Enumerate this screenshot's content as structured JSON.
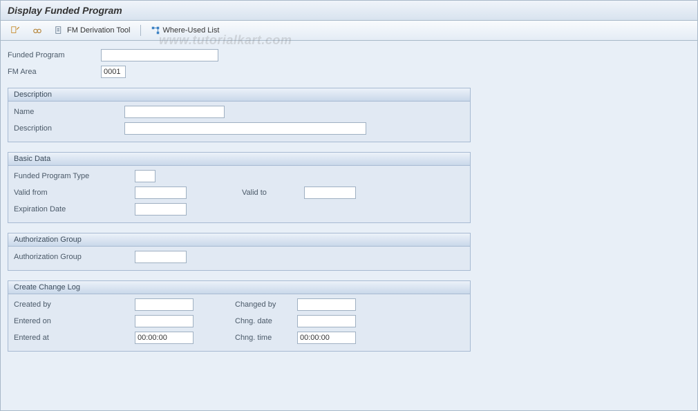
{
  "title": "Display Funded Program",
  "toolbar": {
    "fm_tool": "FM Derivation Tool",
    "where_used": "Where-Used List"
  },
  "header": {
    "funded_program_label": "Funded Program",
    "funded_program_value": "",
    "fm_area_label": "FM Area",
    "fm_area_value": "0001"
  },
  "panels": {
    "description": {
      "title": "Description",
      "name_label": "Name",
      "name_value": "",
      "desc_label": "Description",
      "desc_value": ""
    },
    "basic": {
      "title": "Basic Data",
      "type_label": "Funded Program Type",
      "type_value": "",
      "valid_from_label": "Valid from",
      "valid_from_value": "",
      "valid_to_label": "Valid to",
      "valid_to_value": "",
      "exp_label": "Expiration Date",
      "exp_value": ""
    },
    "auth": {
      "title": "Authorization Group",
      "group_label": "Authorization Group",
      "group_value": ""
    },
    "log": {
      "title": "Create Change Log",
      "created_by_label": "Created by",
      "created_by_value": "",
      "entered_on_label": "Entered on",
      "entered_on_value": "",
      "entered_at_label": "Entered at",
      "entered_at_value": "00:00:00",
      "changed_by_label": "Changed by",
      "changed_by_value": "",
      "chng_date_label": "Chng. date",
      "chng_date_value": "",
      "chng_time_label": "Chng. time",
      "chng_time_value": "00:00:00"
    }
  },
  "watermark": "www.tutorialkart.com"
}
